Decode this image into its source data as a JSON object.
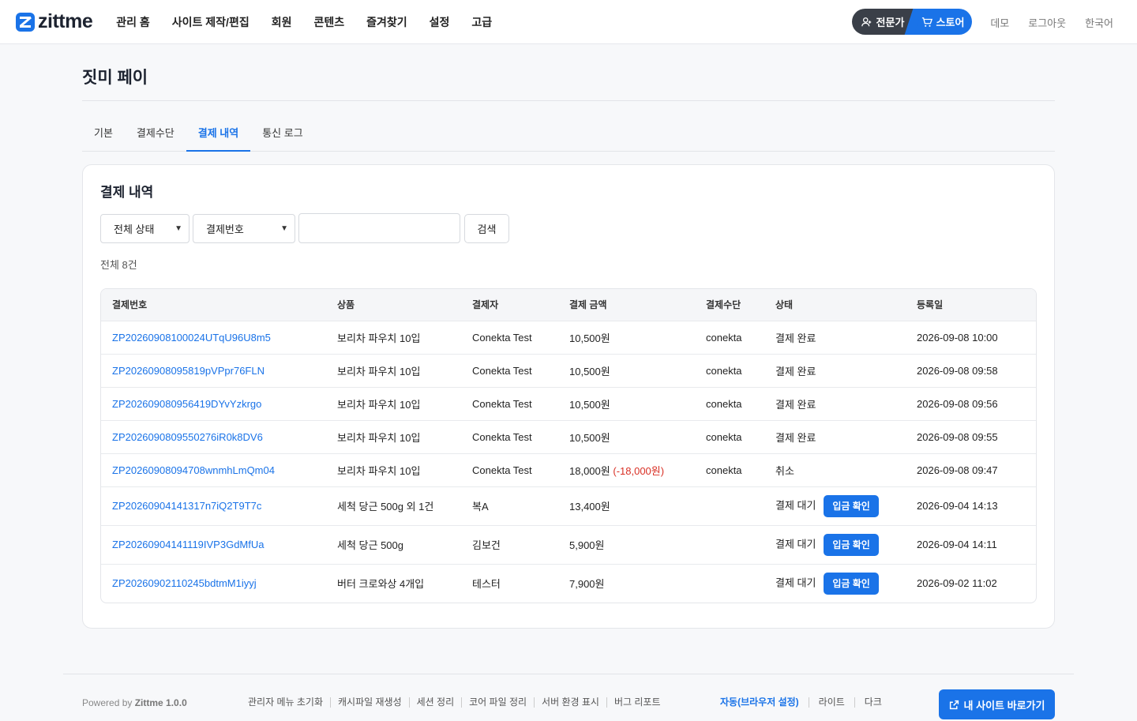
{
  "header": {
    "logo_text": "zittme",
    "nav": [
      "관리 홈",
      "사이트 제작/편집",
      "회원",
      "콘텐츠",
      "즐겨찾기",
      "설정",
      "고급"
    ],
    "mode_expert": "전문가",
    "mode_store": "스토어",
    "links": [
      "데모",
      "로그아웃",
      "한국어"
    ]
  },
  "page": {
    "title": "짓미 페이",
    "tabs": [
      "기본",
      "결제수단",
      "결제 내역",
      "통신 로그"
    ],
    "active_tab": "결제 내역"
  },
  "card": {
    "title": "결제 내역",
    "filter_status": "전체 상태",
    "filter_field": "결제번호",
    "search_value": "",
    "search_button": "검색",
    "total": "전체 8건"
  },
  "table": {
    "headers": [
      "결제번호",
      "상품",
      "결제자",
      "결제 금액",
      "결제수단",
      "상태",
      "등록일"
    ],
    "rows": [
      {
        "id": "ZP20260908100024UTqU96U8m5",
        "product": "보리차 파우치 10입",
        "payer": "Conekta Test",
        "amount": "10,500원",
        "refund": "",
        "method": "conekta",
        "status": "결제 완료",
        "action": "",
        "date": "2026-09-08 10:00"
      },
      {
        "id": "ZP2026090809581​9pVPpr76FLN",
        "product": "보리차 파우치 10입",
        "payer": "Conekta Test",
        "amount": "10,500원",
        "refund": "",
        "method": "conekta",
        "status": "결제 완료",
        "action": "",
        "date": "2026-09-08 09:58"
      },
      {
        "id": "ZP202609080956419DYvYzkrgo",
        "product": "보리차 파우치 10입",
        "payer": "Conekta Test",
        "amount": "10,500원",
        "refund": "",
        "method": "conekta",
        "status": "결제 완료",
        "action": "",
        "date": "2026-09-08 09:56"
      },
      {
        "id": "ZP2026090809550276iR0k8DV6",
        "product": "보리차 파우치 10입",
        "payer": "Conekta Test",
        "amount": "10,500원",
        "refund": "",
        "method": "conekta",
        "status": "결제 완료",
        "action": "",
        "date": "2026-09-08 09:55"
      },
      {
        "id": "ZP20260908094708wnmhLmQm04",
        "product": "보리차 파우치 10입",
        "payer": "Conekta Test",
        "amount": "18,000원",
        "refund": "(-18,000원)",
        "method": "conekta",
        "status": "취소",
        "action": "",
        "date": "2026-09-08 09:47"
      },
      {
        "id": "ZP20260904141317n7iQ2T9T7c",
        "product": "세척 당근 500g 외 1건",
        "payer": "복A",
        "amount": "13,400원",
        "refund": "",
        "method": "",
        "status": "결제 대기",
        "action": "입금 확인",
        "date": "2026-09-04 14:13"
      },
      {
        "id": "ZP20260904141119IVP3GdMfUa",
        "product": "세척 당근 500g",
        "payer": "김보건",
        "amount": "5,900원",
        "refund": "",
        "method": "",
        "status": "결제 대기",
        "action": "입금 확인",
        "date": "2026-09-04 14:11"
      },
      {
        "id": "ZP20260902110245bdtmM1iyyj",
        "product": "버터 크로와상 4개입",
        "payer": "테스터",
        "amount": "7,900원",
        "refund": "",
        "method": "",
        "status": "결제 대기",
        "action": "입금 확인",
        "date": "2026-09-02 11:02"
      }
    ]
  },
  "footer": {
    "powered_prefix": "Powered by",
    "powered_brand": "Zittme 1.0.0",
    "links": [
      "관리자 메뉴 초기화",
      "캐시파일 재생성",
      "세션 정리",
      "코어 파일 정리",
      "서버 환경 표시",
      "버그 리포트"
    ],
    "themes": [
      "자동(브라우저 설정)",
      "라이트",
      "다크"
    ],
    "visit_button": "내 사이트 바로가기"
  },
  "colors": {
    "accent": "#1a73e8",
    "danger": "#d93025",
    "dark": "#3a3f48"
  }
}
